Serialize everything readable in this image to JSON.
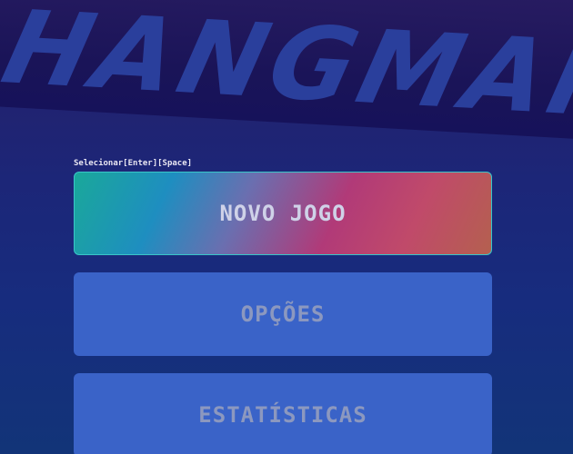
{
  "title": "HANGMAN",
  "hint": "Selecionar[Enter][Space]",
  "menu": {
    "items": [
      {
        "label": "NOVO JOGO",
        "selected": true
      },
      {
        "label": "OPÇÕES",
        "selected": false
      },
      {
        "label": "ESTATÍSTICAS",
        "selected": false
      }
    ]
  },
  "colors": {
    "background": "#1c2678",
    "button": "#3a63c8",
    "selected_border": "#39c6c8"
  }
}
